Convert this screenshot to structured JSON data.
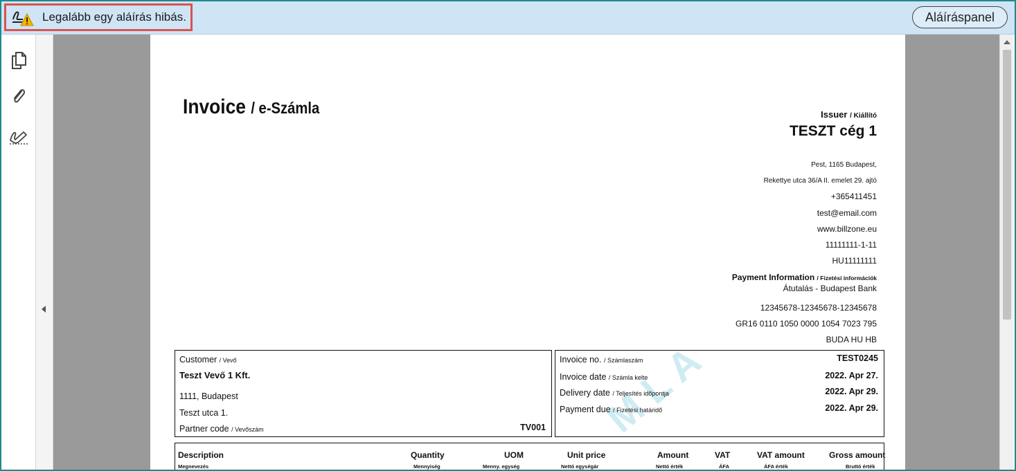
{
  "signature_bar": {
    "warning_text": "Legalább egy aláírás hibás.",
    "panel_button": "Aláíráspanel"
  },
  "sidebar": {
    "tools": [
      "pages-icon",
      "attachment-icon",
      "signature-icon"
    ]
  },
  "invoice": {
    "title": "Invoice",
    "title_sub": "/ e-Számla",
    "issuer": {
      "label": "Issuer",
      "label_sub": "/ Kiállító",
      "name": "TESZT cég 1",
      "address1": "Pest, 1165 Budapest,",
      "address2": "Rekettye utca 36/A II. emelet 29. ajtó",
      "phone": "+365411451",
      "email": "test@email.com",
      "web": "www.billzone.eu",
      "tax_id": "11111111-1-11",
      "eu_tax_id": "HU11111111",
      "payment_label": "Payment Information",
      "payment_label_sub": "/ Fizetési információk",
      "payment_method": "Átutalás - Budapest Bank",
      "account": "12345678-12345678-12345678",
      "iban": "GR16 0110 1050 0000 1054 7023 795",
      "swift": "BUDA HU HB"
    },
    "customer": {
      "label": "Customer",
      "label_sub": "/ Vevő",
      "name": "Teszt Vevő 1 Kft.",
      "city": "1111, Budapest",
      "street": "Teszt utca 1.",
      "partner_label": "Partner code",
      "partner_label_sub": "/ Vevőszám",
      "partner_code": "TV001"
    },
    "details": {
      "invoice_no_label": "Invoice no.",
      "invoice_no_sub": "/ Számlaszám",
      "invoice_no": "TEST0245",
      "invoice_date_label": "Invoice date",
      "invoice_date_sub": "/ Számla kelte",
      "invoice_date": "2022. Apr 27.",
      "delivery_label": "Delivery date",
      "delivery_sub": "/ Teljesítés időpontja",
      "delivery_date": "2022. Apr 29.",
      "due_label": "Payment due",
      "due_sub": "/ Fizetési határidő",
      "due_date": "2022. Apr 29."
    },
    "watermark": "M L A",
    "table": {
      "headers": [
        "Description",
        "Quantity",
        "UOM",
        "Unit price",
        "Amount",
        "VAT",
        "VAT amount",
        "Gross amount"
      ],
      "subheaders": [
        "Megnevezés",
        "Mennyiség",
        "Menny. egység",
        "Nettó egységár",
        "Nettó érték",
        "ÁFA",
        "ÁFA érték",
        "Bruttó érték"
      ]
    }
  }
}
